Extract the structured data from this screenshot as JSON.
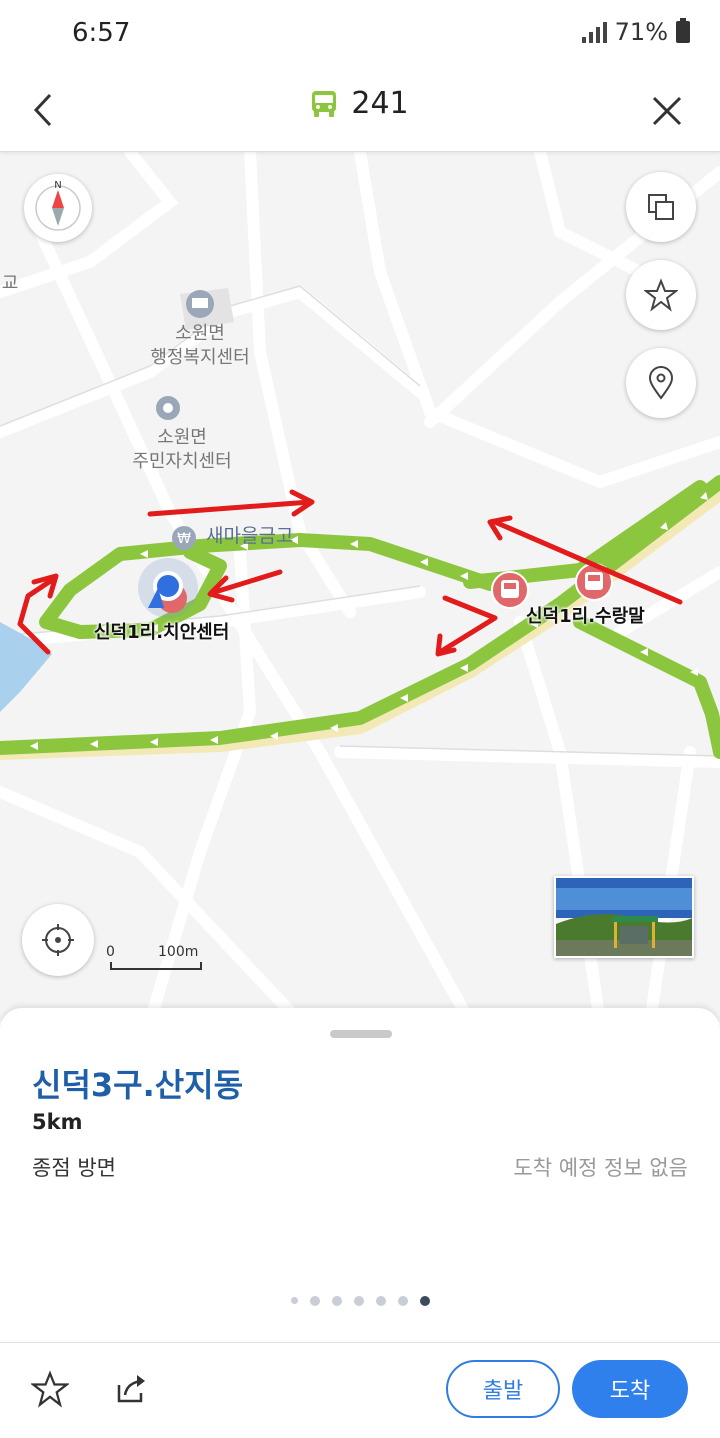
{
  "status_bar": {
    "time": "6:57",
    "battery": "71%"
  },
  "header": {
    "route_number": "241"
  },
  "map": {
    "labels": {
      "partial_left": "교",
      "admin_center": "소원면\n행정복지센터",
      "resident_center": "소원면\n주민자치센터",
      "saemaeul": "새마을금고"
    },
    "bus_stops": {
      "current": "신덕1리.치안센터",
      "next": "신덕1리.수랑말"
    },
    "scale": {
      "zero": "0",
      "distance": "100m"
    }
  },
  "sheet": {
    "stop_name": "신덕3구.산지동",
    "distance": "5km",
    "direction": "종점 방면",
    "arrival_info": "도착 예정 정보 없음",
    "page_count": 7,
    "active_page": 6
  },
  "actions": {
    "depart_label": "출발",
    "arrive_label": "도착"
  },
  "colors": {
    "route": "#8cc63f",
    "accent": "#2f80ed",
    "stop_marker": "#e0686a",
    "annotation": "#e21b1b",
    "title": "#1f5fa8"
  }
}
